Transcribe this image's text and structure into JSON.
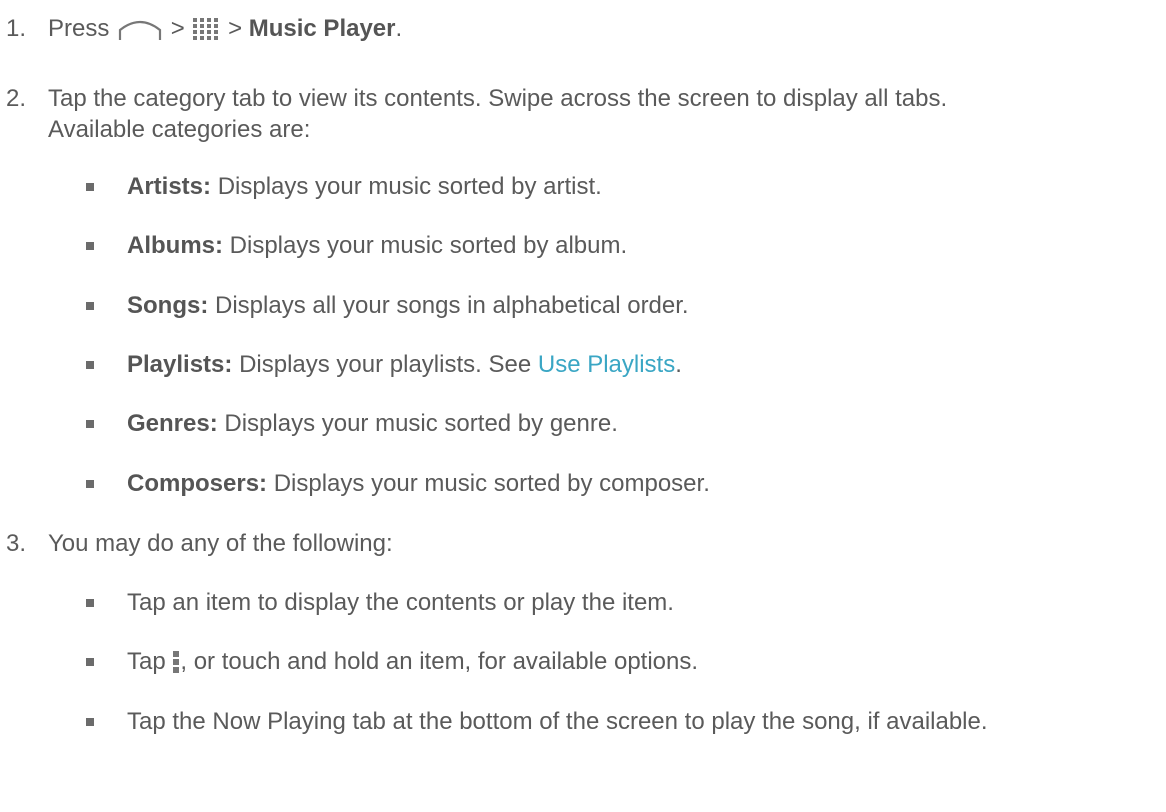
{
  "step1": {
    "number": "1.",
    "text_press": "Press",
    "sep1": ">",
    "sep2": ">",
    "app_name": "Music Player",
    "period": ".",
    "icons": [
      "home-icon",
      "apps-grid-icon"
    ]
  },
  "step2": {
    "number": "2.",
    "line1": "Tap the category tab to view its contents. Swipe across the screen to display all tabs.",
    "line2": "Available categories are:",
    "categories": [
      {
        "label": "Artists:",
        "desc": "Displays your music sorted by artist."
      },
      {
        "label": "Albums:",
        "desc": "Displays your music sorted by album."
      },
      {
        "label": "Songs:",
        "desc": "Displays all your songs in alphabetical order."
      },
      {
        "label": "Playlists:",
        "desc": "Displays your playlists. See",
        "link": "Use Playlists",
        "after": "."
      },
      {
        "label": "Genres:",
        "desc": "Displays your music sorted by genre."
      },
      {
        "label": "Composers:",
        "desc": "Displays your music sorted by composer."
      }
    ]
  },
  "step3": {
    "number": "3.",
    "intro": "You may do any of the following:",
    "options": [
      {
        "text": "Tap an item to display the contents or play the item."
      },
      {
        "before": "Tap",
        "icon": "menu-icon",
        "after": ", or touch and hold an item, for available options."
      },
      {
        "text": "Tap the Now Playing tab at the bottom of the screen to play the song, if available."
      }
    ]
  },
  "colors": {
    "text": "#5a5a5a",
    "link": "#3aa6c4",
    "icon": "#7a7a7a"
  }
}
